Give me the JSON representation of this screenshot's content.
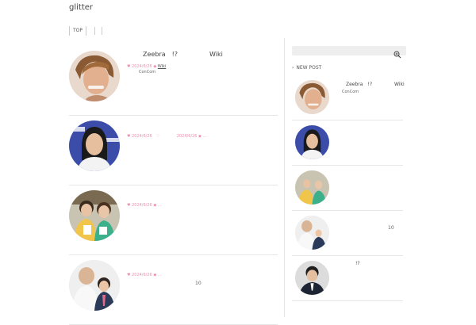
{
  "site": {
    "title": "glitter"
  },
  "nav": {
    "top_label": "TOP"
  },
  "posts": [
    {
      "title_a": "Zeebra　!?",
      "title_b": "Wiki",
      "meta": "2024/6/26",
      "tag_link": "Wiki",
      "tag_tail": "　",
      "author": "ConCom",
      "number": ""
    },
    {
      "title_a": "",
      "title_b": "",
      "meta": "2024/6/26　♡　　　　 2024/6/26",
      "tag_link": "",
      "tag_tail": "…",
      "author": "",
      "number": ""
    },
    {
      "title_a": "",
      "title_b": "",
      "meta": "2024/6/26",
      "tag_link": "",
      "tag_tail": "…",
      "author": "",
      "number": ""
    },
    {
      "title_a": "",
      "title_b": "",
      "meta": "2024/6/26",
      "tag_link": "",
      "tag_tail": "…",
      "author": "",
      "number": "10"
    }
  ],
  "sidebar": {
    "search_placeholder": "",
    "new_post_label": "NEW POST",
    "items": [
      {
        "title_a": "Zeebra　!?",
        "title_b": "Wiki",
        "author": "ConCom",
        "number": ""
      },
      {
        "title_a": "",
        "title_b": "",
        "author": "",
        "number": ""
      },
      {
        "title_a": "",
        "title_b": "",
        "author": "",
        "number": ""
      },
      {
        "title_a": "",
        "title_b": "",
        "author": "",
        "number": "10"
      },
      {
        "title_a": "!?",
        "title_b": "",
        "author": "",
        "number": ""
      }
    ]
  },
  "colors": {
    "accent_pink": "#f08fb0",
    "divider": "#e6e6e6",
    "search_bg": "#eeeeee"
  },
  "icons": {
    "search": "zoom-in-icon",
    "chevron": "chevron-right-icon",
    "heart": "heart-icon",
    "tag": "tag-icon"
  }
}
